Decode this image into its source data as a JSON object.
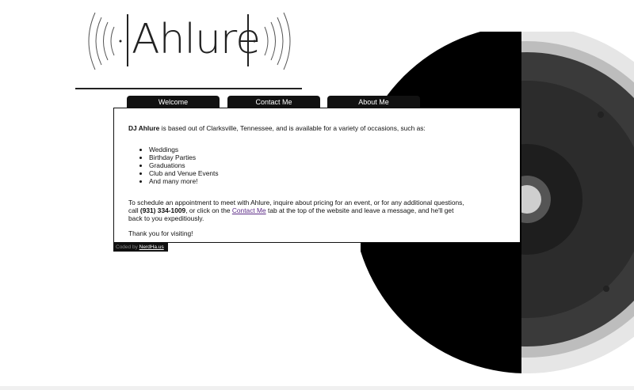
{
  "logo": {
    "text": "Ahlure"
  },
  "nav": {
    "tabs": [
      {
        "label": "Welcome"
      },
      {
        "label": "Contact Me"
      },
      {
        "label": "About Me"
      }
    ]
  },
  "welcome": {
    "intro_name": "DJ Ahlure",
    "intro_rest": " is based out of Clarksville, Tennessee, and is available for a variety of occasions, such as:",
    "occasions": [
      "Weddings",
      "Birthday Parties",
      "Graduations",
      "Club and Venue Events",
      "And many more!"
    ],
    "schedule_part1": "To schedule an appointment to meet with Ahlure, inquire about pricing for an event, or for any additional questions, call ",
    "phone": "(931) 334-1009",
    "schedule_part2": ", or click on the ",
    "contact_link": "Contact Me",
    "schedule_part3": " tab at the top of the website and leave a message, and he'll get back to you expeditiously.",
    "thanks": "Thank you for visiting!"
  },
  "footer": {
    "coded_by": "Coded by",
    "link": "NerdHa.us"
  },
  "colors": {
    "tab_bg": "#111111",
    "link": "#5b2a86"
  }
}
